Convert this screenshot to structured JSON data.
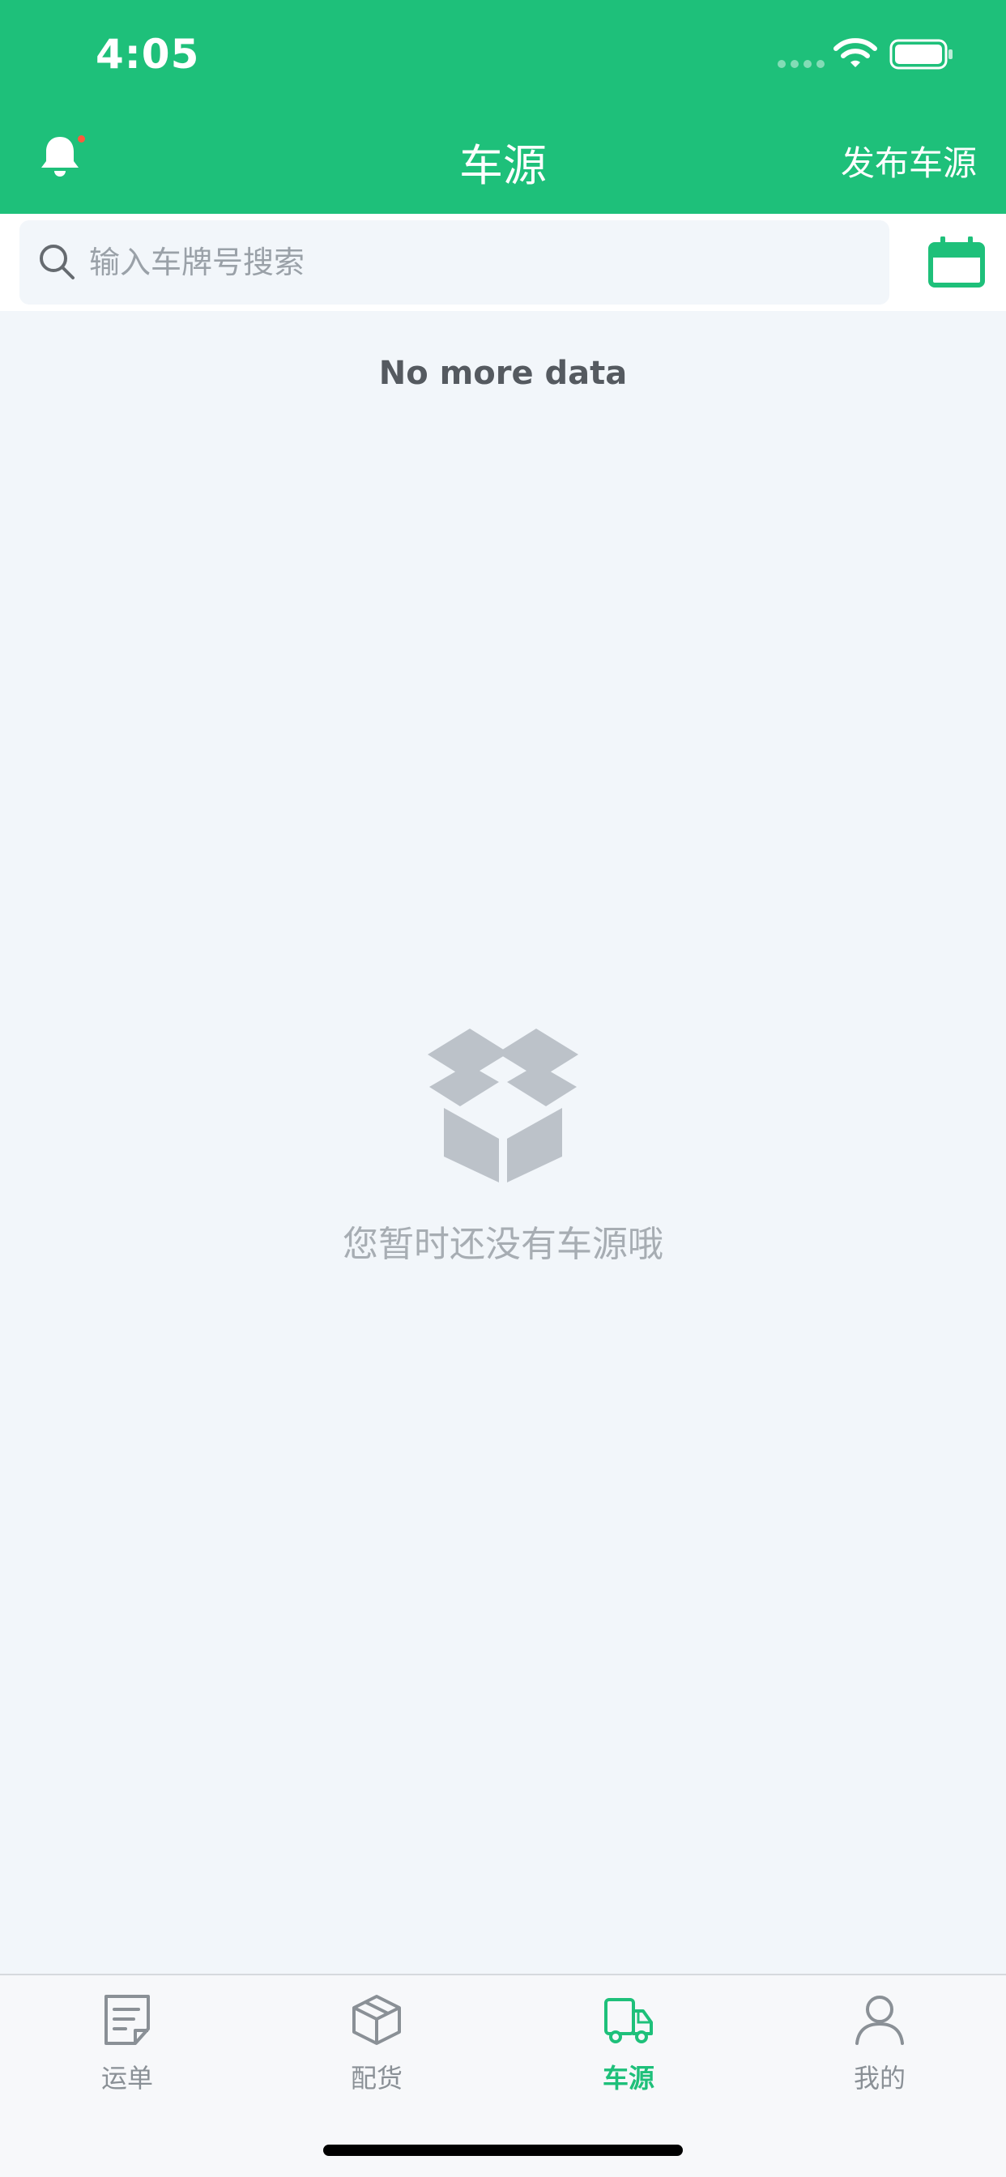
{
  "status_bar": {
    "time": "4:05"
  },
  "nav": {
    "title": "车源",
    "publish_label": "发布车源"
  },
  "search": {
    "placeholder": "输入车牌号搜索",
    "value": ""
  },
  "content": {
    "no_more_text": "No more data",
    "empty_text": "您暂时还没有车源哦"
  },
  "tabs": [
    {
      "label": "运单",
      "icon": "waybill-icon",
      "active": false
    },
    {
      "label": "配货",
      "icon": "cargo-box-icon",
      "active": false
    },
    {
      "label": "车源",
      "icon": "truck-icon",
      "active": true
    },
    {
      "label": "我的",
      "icon": "profile-icon",
      "active": false
    }
  ],
  "colors": {
    "brand": "#1ec07a",
    "background": "#f2f6fa",
    "tab_inactive": "#8a9096",
    "notification_dot": "#ff5a3c"
  }
}
